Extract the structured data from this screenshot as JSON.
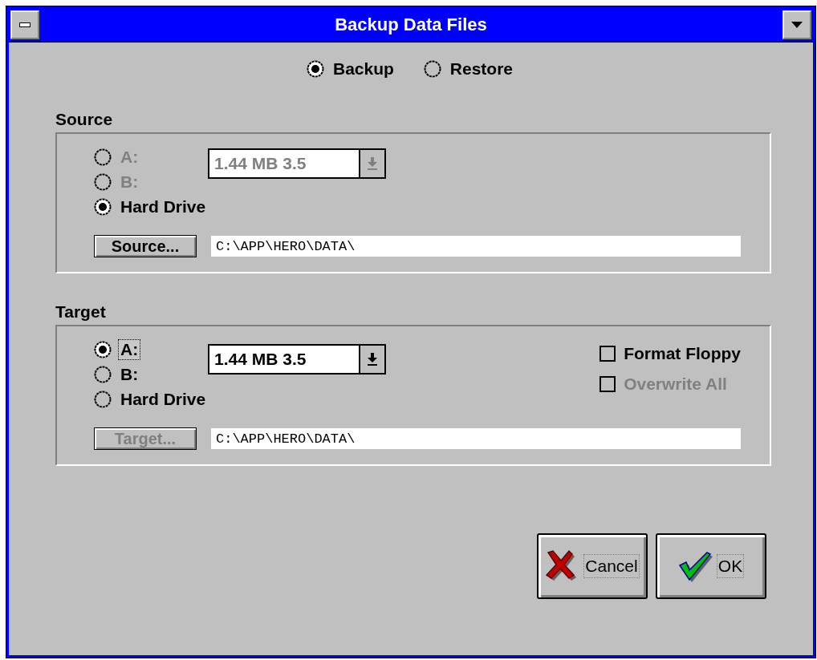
{
  "window": {
    "title": "Backup Data Files"
  },
  "mode": [
    {
      "label": "Backup",
      "selected": true
    },
    {
      "label": "Restore",
      "selected": false
    }
  ],
  "source": {
    "title": "Source",
    "drives": [
      {
        "label": "A:",
        "selected": false,
        "disabled": true,
        "focused": false
      },
      {
        "label": "B:",
        "selected": false,
        "disabled": true,
        "focused": false
      },
      {
        "label": "Hard Drive",
        "selected": true,
        "disabled": false,
        "focused": false
      }
    ],
    "drive_type": {
      "value": "1.44 MB 3.5",
      "disabled": true
    },
    "browse_button": {
      "label": "Source...",
      "disabled": false
    },
    "path": "C:\\APP\\HERO\\DATA\\"
  },
  "target": {
    "title": "Target",
    "drives": [
      {
        "label": "A:",
        "selected": true,
        "disabled": false,
        "focused": true
      },
      {
        "label": "B:",
        "selected": false,
        "disabled": false,
        "focused": false
      },
      {
        "label": "Hard Drive",
        "selected": false,
        "disabled": false,
        "focused": false
      }
    ],
    "drive_type": {
      "value": "1.44 MB 3.5",
      "disabled": false
    },
    "options": [
      {
        "label": "Format Floppy",
        "checked": false,
        "disabled": false
      },
      {
        "label": "Overwrite All",
        "checked": false,
        "disabled": true
      }
    ],
    "browse_button": {
      "label": "Target...",
      "disabled": true
    },
    "path": "C:\\APP\\HERO\\DATA\\"
  },
  "buttons": [
    {
      "label": "Cancel",
      "kind": "cancel"
    },
    {
      "label": "OK",
      "kind": "ok"
    }
  ]
}
